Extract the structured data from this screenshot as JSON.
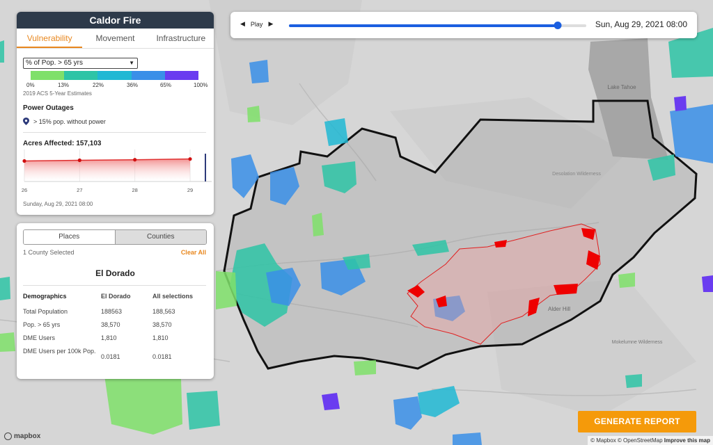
{
  "app": {
    "fire_name": "Caldor Fire"
  },
  "tabs": [
    {
      "label": "Vulnerability",
      "active": true
    },
    {
      "label": "Movement",
      "active": false
    },
    {
      "label": "Infrastructure",
      "active": false
    }
  ],
  "layer_select": {
    "value": "% of Pop. > 65 yrs"
  },
  "legend": {
    "colors": [
      "#7fe06a",
      "#2ec4a6",
      "#20b8d4",
      "#3a8fe8",
      "#4a6ef0",
      "#6a3cf0"
    ],
    "labels": [
      "0%",
      "13%",
      "22%",
      "36%",
      "65%",
      "100%"
    ],
    "source": "2019 ACS 5-Year Estimates"
  },
  "power_outages": {
    "title": "Power Outages",
    "item": "> 15% pop. without power"
  },
  "acres": {
    "title": "Acres Affected: 157,103",
    "x_labels": [
      "26",
      "27",
      "28",
      "29"
    ],
    "date": "Sunday, Aug 29, 2021 08:00"
  },
  "chart_data": {
    "type": "area",
    "title": "Acres Affected: 157,103",
    "categories": [
      "26",
      "27",
      "28",
      "29"
    ],
    "series": [
      {
        "values": [
          135000,
          143000,
          149000,
          157103
        ]
      }
    ],
    "current_marker": "29",
    "colors": {
      "line": "#e03030",
      "fill": "#f4a0a0"
    }
  },
  "places": {
    "tabs": [
      {
        "label": "Places",
        "selected": false
      },
      {
        "label": "Counties",
        "selected": true
      }
    ],
    "count_text": "1 County Selected",
    "clear_label": "Clear All",
    "county": "El Dorado",
    "table": {
      "headers": [
        "Demographics",
        "El Dorado",
        "All selections"
      ],
      "rows": [
        [
          "Total Population",
          "188563",
          "188,563"
        ],
        [
          "Pop. > 65 yrs",
          "38,570",
          "38,570"
        ],
        [
          "DME Users",
          "1,810",
          "1,810"
        ],
        [
          "DME Users per 100k Pop.",
          "0.0181",
          "0.0181"
        ]
      ]
    }
  },
  "timeline": {
    "play_label": "Play",
    "timestamp": "Sun, Aug 29, 2021 08:00",
    "progress": 0.905
  },
  "generate_label": "GENERATE REPORT",
  "map_labels": {
    "lake": "Lake Tahoe",
    "wilderness": "Desolation Wilderness",
    "town": "Alder Hill",
    "wild2": "Mokelumne Wilderness"
  },
  "attribution": {
    "logo": "mapbox",
    "mapbox": "© Mapbox",
    "osm": "© OpenStreetMap",
    "improve": "Improve this map"
  }
}
